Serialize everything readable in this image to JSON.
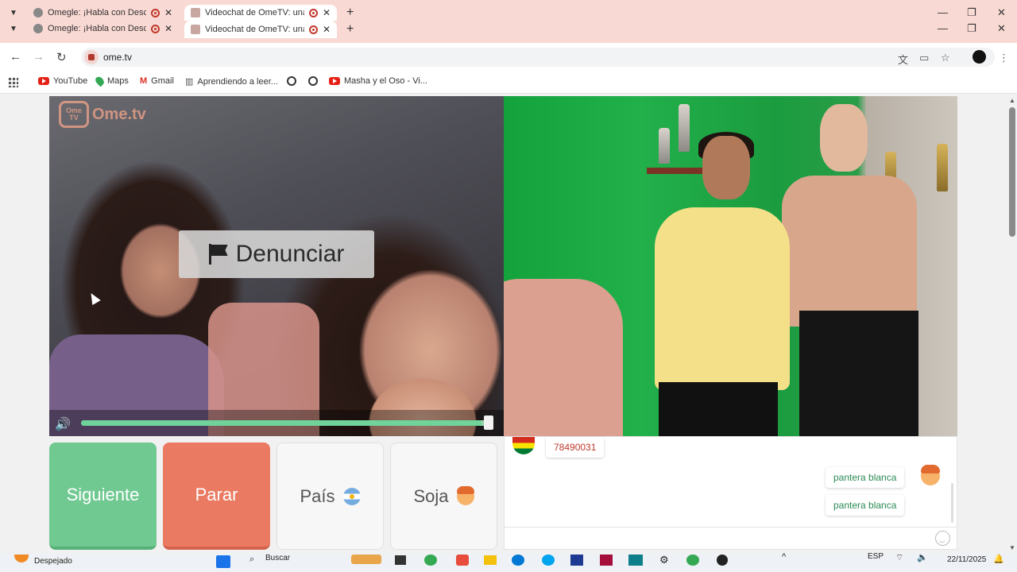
{
  "tabs": [
    {
      "title": "Omegle: ¡Habla con Descon",
      "active": false
    },
    {
      "title": "Videochat de OmeTV: una",
      "active": true
    }
  ],
  "window_controls": {
    "minimize": "—",
    "restore": "❐",
    "close": "✕"
  },
  "address_bar": {
    "url": "ome.tv"
  },
  "bookmarks": [
    {
      "label": "YouTube",
      "icon": "youtube-icon"
    },
    {
      "label": "Maps",
      "icon": "maps-icon"
    },
    {
      "label": "Gmail",
      "icon": "gmail-icon"
    },
    {
      "label": "Aprendiendo a leer...",
      "icon": "bookmark-icon"
    },
    {
      "label": "",
      "icon": "globe-icon"
    },
    {
      "label": "",
      "icon": "globe-icon"
    },
    {
      "label": "Masha y el Oso - Vi...",
      "icon": "youtube-icon"
    }
  ],
  "video": {
    "logo_badge": "Ome TV",
    "logo_text": "Ome.tv",
    "report_label": "Denunciar",
    "volume_level": 0.98
  },
  "controls": {
    "next_label": "Siguiente",
    "stop_label": "Parar",
    "country_label": "País",
    "gender_label": "Soja"
  },
  "chat": {
    "messages": [
      {
        "from": "stranger",
        "text": "78490031",
        "flag": "bolivia-flag-icon"
      },
      {
        "from": "me",
        "text": "pantera blanca"
      },
      {
        "from": "me",
        "text": "pantera blanca"
      }
    ]
  },
  "taskbar": {
    "weather": "Despejado",
    "search": "Buscar",
    "language": "ESP",
    "date": "22/11/2025"
  },
  "colors": {
    "next": "#71c992",
    "stop": "#ea7a62",
    "chrome": "#f9d9d3"
  }
}
